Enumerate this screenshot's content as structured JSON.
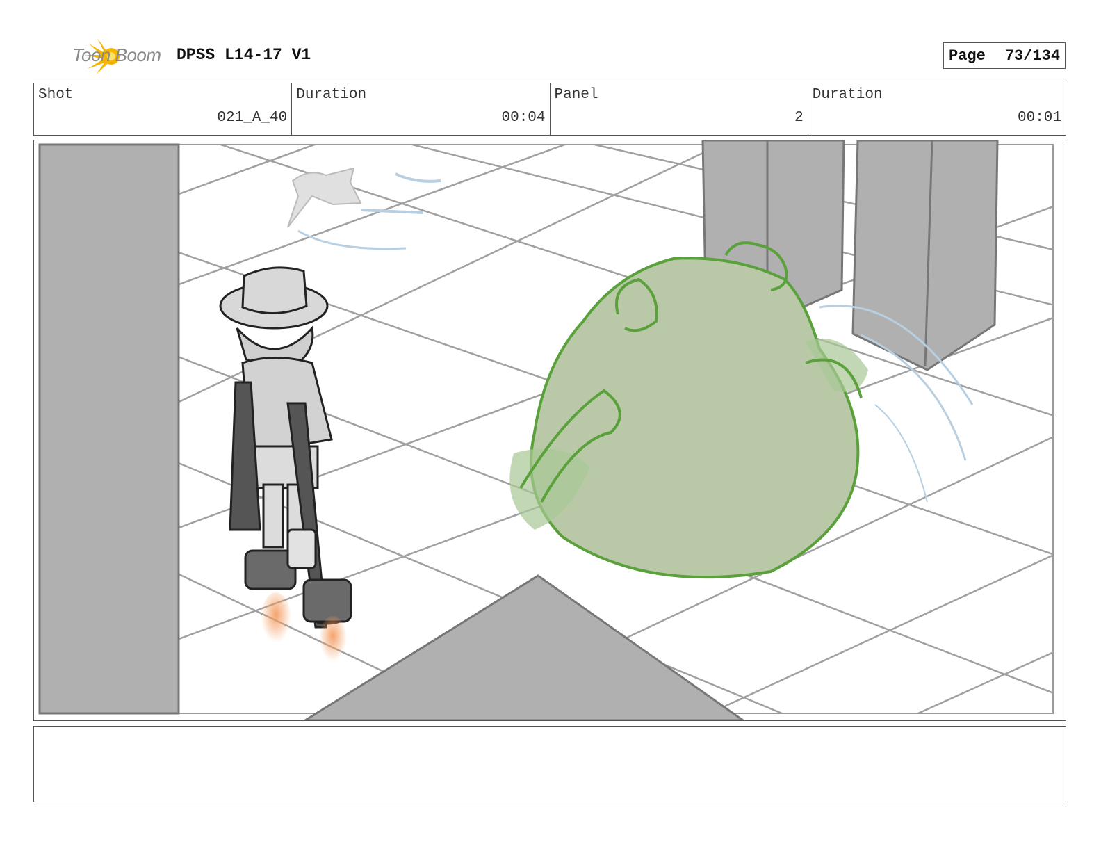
{
  "header": {
    "logo_text": "Toon Boom",
    "doc_title": "DPSS L14-17 V1",
    "page_label": "Page",
    "page_number": "73/134"
  },
  "info": {
    "shot_label": "Shot",
    "shot_value": "021_A_40",
    "duration_label": "Duration",
    "duration_value": "00:04",
    "panel_label": "Panel",
    "panel_value": "2",
    "panel_duration_label": "Duration",
    "panel_duration_value": "00:01"
  },
  "panel_art": {
    "description_icons": [
      "boy-with-crutches-and-rocket-boots",
      "green-slime-blob",
      "toy-plane",
      "gray-pillars"
    ],
    "colors": {
      "floor_grid": "#9a9a9a",
      "pillar": "#b0b0b0",
      "blob": "#b9c9a8",
      "blob_line": "#5aa13c",
      "flame": "#f3a06b",
      "motion": "#b7cfe0"
    }
  },
  "caption": {
    "text": ""
  }
}
